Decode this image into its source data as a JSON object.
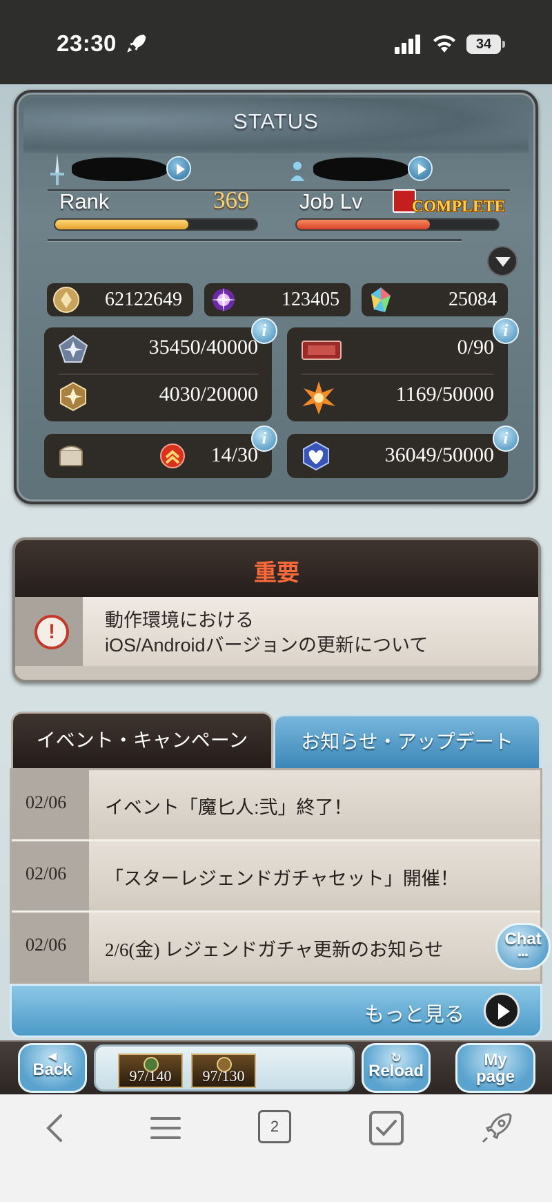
{
  "ios_status": {
    "time": "23:30",
    "battery": "34"
  },
  "status_panel": {
    "title": "STATUS",
    "rank": {
      "label": "Rank",
      "value": "369",
      "progress": 0.66
    },
    "job": {
      "label": "Job Lv",
      "badge": "COMPLETE",
      "progress": 0.66
    },
    "currencies": [
      {
        "icon": "rupie-coin-icon",
        "value": "62122649"
      },
      {
        "icon": "crystal-orb-icon",
        "value": "123405"
      },
      {
        "icon": "rainbow-gem-icon",
        "value": "25084"
      }
    ],
    "stats": {
      "stat1": {
        "icon": "pentagon-crest-icon",
        "value": "35450/40000"
      },
      "stat2": {
        "icon": "gold-crest-icon",
        "value": "4030/20000"
      },
      "stat3": {
        "icon": "ticket-icon",
        "value": "0/90"
      },
      "stat4": {
        "icon": "star-burst-icon",
        "value": "1169/50000"
      },
      "stat5": {
        "icon": "treasure-chest-icon",
        "value": "14/30"
      },
      "stat6": {
        "icon": "blue-heart-icon",
        "value": "36049/50000"
      }
    },
    "info_label": "i"
  },
  "notice": {
    "title": "重要",
    "line1": "動作環境における",
    "line2": "iOS/Androidバージョンの更新について"
  },
  "tabs": {
    "events": "イベント・キャンペーン",
    "updates": "お知らせ・アップデート"
  },
  "news": [
    {
      "date": "02/06",
      "title": "イベント「魔匕人:弐」終了！"
    },
    {
      "date": "02/06",
      "title": "「スターレジェンドガチャセット」開催！"
    },
    {
      "date": "02/06",
      "title": "2/6(金) レジェンドガチャ更新のお知らせ"
    }
  ],
  "more_label": "もっと見る",
  "chat_label": "Chat",
  "chat_dots": "•••",
  "game_nav": {
    "back": "Back",
    "ap": "97/140",
    "bp": "97/130",
    "reload": "Reload",
    "mypage_1": "My",
    "mypage_2": "page"
  },
  "safari": {
    "tab_count": "2"
  }
}
